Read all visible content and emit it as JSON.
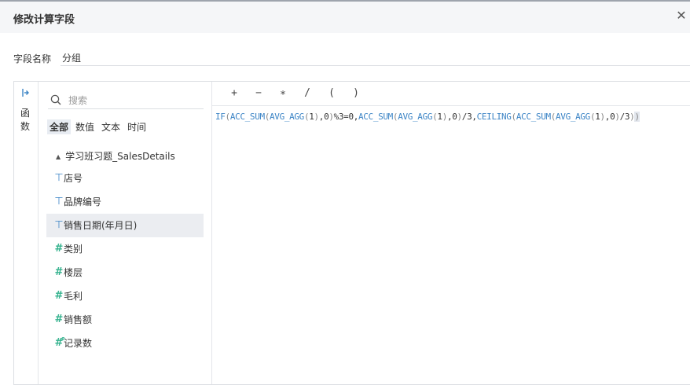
{
  "dialog": {
    "title": "修改计算字段",
    "close_icon": "close-icon"
  },
  "name_field": {
    "label": "字段名称",
    "value": "分组"
  },
  "rail": {
    "icon": "expand-right-icon",
    "label": "函数"
  },
  "search": {
    "placeholder": "搜索",
    "icon": "search-icon"
  },
  "filters": [
    "全部",
    "数值",
    "文本",
    "时间"
  ],
  "active_filter": "全部",
  "dataset": {
    "name": "学习班习题_SalesDetails",
    "fields": [
      {
        "name": "店号",
        "type": "text"
      },
      {
        "name": "品牌编号",
        "type": "text"
      },
      {
        "name": "销售日期(年月日)",
        "type": "text",
        "selected": true
      },
      {
        "name": "类别",
        "type": "number"
      },
      {
        "name": "楼层",
        "type": "number"
      },
      {
        "name": "毛利",
        "type": "number"
      },
      {
        "name": "销售额",
        "type": "number"
      },
      {
        "name": "记录数",
        "type": "number-calc"
      }
    ]
  },
  "operators": [
    "+",
    "−",
    "∗",
    "/",
    "(",
    ")"
  ],
  "formula": {
    "tokens": [
      {
        "t": "IF",
        "c": "fn"
      },
      {
        "t": "(",
        "c": "par"
      },
      {
        "t": "ACC_SUM",
        "c": "fn"
      },
      {
        "t": "(",
        "c": "par"
      },
      {
        "t": "AVG_AGG",
        "c": "fn"
      },
      {
        "t": "(",
        "c": "par"
      },
      {
        "t": "1",
        "c": ""
      },
      {
        "t": ")",
        "c": "par"
      },
      {
        "t": ",0",
        "c": ""
      },
      {
        "t": ")",
        "c": "par"
      },
      {
        "t": "%3=0,",
        "c": ""
      },
      {
        "t": "ACC_SUM",
        "c": "fn"
      },
      {
        "t": "(",
        "c": "par"
      },
      {
        "t": "AVG_AGG",
        "c": "fn"
      },
      {
        "t": "(",
        "c": "par"
      },
      {
        "t": "1",
        "c": ""
      },
      {
        "t": ")",
        "c": "par"
      },
      {
        "t": ",0",
        "c": ""
      },
      {
        "t": ")",
        "c": "par"
      },
      {
        "t": "/3,",
        "c": ""
      },
      {
        "t": "CEILING",
        "c": "fn"
      },
      {
        "t": "(",
        "c": "par"
      },
      {
        "t": "ACC_SUM",
        "c": "fn"
      },
      {
        "t": "(",
        "c": "par"
      },
      {
        "t": "AVG_AGG",
        "c": "fn"
      },
      {
        "t": "(",
        "c": "par"
      },
      {
        "t": "1",
        "c": ""
      },
      {
        "t": ")",
        "c": "par"
      },
      {
        "t": ",0",
        "c": ""
      },
      {
        "t": ")",
        "c": "par"
      },
      {
        "t": "/3",
        "c": ""
      },
      {
        "t": ")",
        "c": "par"
      },
      {
        "t": ")",
        "c": "lastpar"
      }
    ]
  },
  "colors": {
    "accent_blue": "#3d85c6",
    "number_green": "#34b28e",
    "selected_bg": "#ebedf1"
  }
}
